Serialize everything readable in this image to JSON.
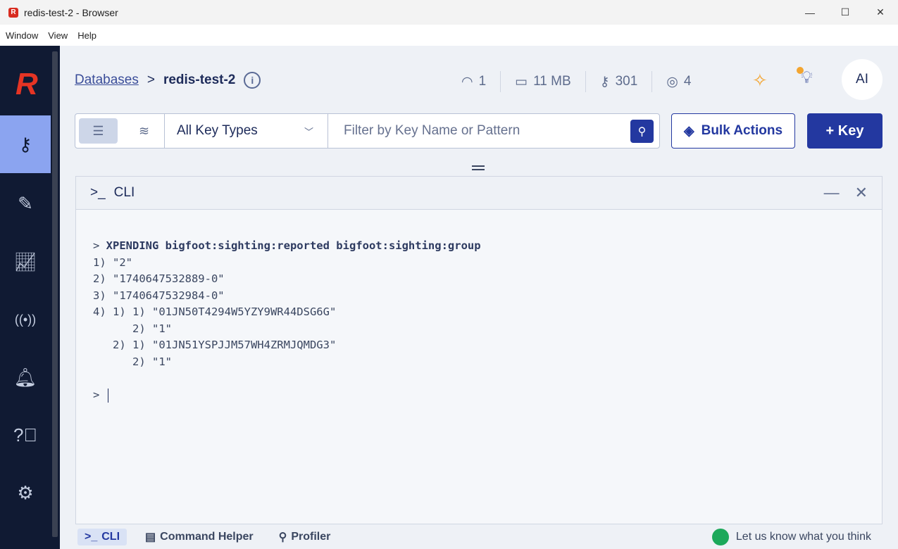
{
  "window": {
    "title": "redis-test-2 - Browser",
    "menu": [
      "Window",
      "View",
      "Help"
    ]
  },
  "breadcrumb": {
    "root": "Databases",
    "separator": ">",
    "current": "redis-test-2"
  },
  "stats": {
    "clients": "1",
    "memory": "11 MB",
    "keys": "301",
    "users": "4"
  },
  "avatar": "AI",
  "filter": {
    "key_type": "All Key Types",
    "placeholder": "Filter by Key Name or Pattern"
  },
  "buttons": {
    "bulk": "Bulk Actions",
    "add_key": "+ Key"
  },
  "cli": {
    "title": "CLI",
    "prompt_symbol": ">_",
    "command": "XPENDING bigfoot:sighting:reported bigfoot:sighting:group",
    "output": [
      "1) \"2\"",
      "2) \"1740647532889-0\"",
      "3) \"1740647532984-0\"",
      "4) 1) 1) \"01JN50T4294W5YZY9WR44DSG6G\"",
      "      2) \"1\"",
      "   2) 1) \"01JN51YSPJJM57WH4ZRMJQMDG3\"",
      "      2) \"1\""
    ],
    "prompt": ">"
  },
  "bottom": {
    "cli": "CLI",
    "helper": "Command Helper",
    "profiler": "Profiler",
    "feedback": "Let us know what you think"
  },
  "colors": {
    "primary": "#2338a0",
    "sidebar": "#101a33",
    "logo": "#e53424",
    "active_nav": "#8ba4f0"
  }
}
